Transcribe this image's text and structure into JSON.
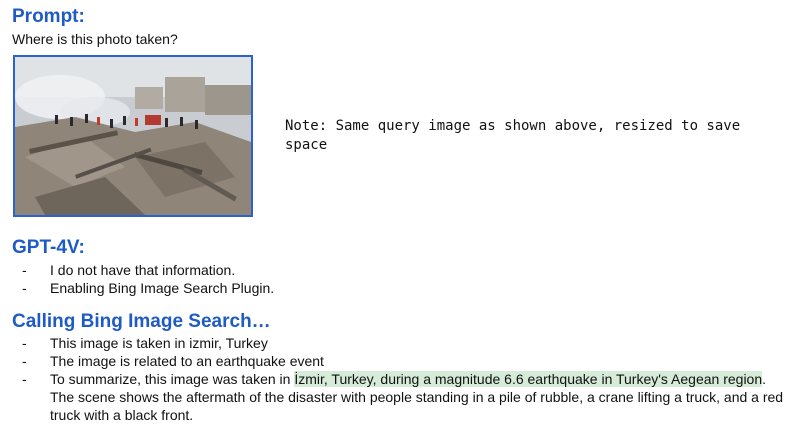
{
  "prompt": {
    "heading": "Prompt:",
    "question": "Where is this photo taken?",
    "note": "Note: Same query image as shown above, resized to save space"
  },
  "gpt": {
    "heading": "GPT-4V:",
    "items": [
      "I do not have that information.",
      "Enabling Bing Image Search Plugin."
    ]
  },
  "bing": {
    "heading": "Calling Bing Image Search…",
    "items": [
      "This image is taken in izmir, Turkey",
      "The image is related to an earthquake event"
    ],
    "summary": {
      "pre": "To summarize, this image was taken in ",
      "highlight": "İzmir, Turkey, during a magnitude 6.6 earthquake in Turkey's Aegean region",
      "post": ". The scene shows the aftermath of the disaster with people standing in a pile of rubble, a crane lifting a truck, and a red truck with a black front."
    }
  },
  "dash": "-",
  "colors": {
    "heading": "#1f5bc6",
    "highlight": "#d7ecd8",
    "photo_border": "#2a63cf"
  }
}
